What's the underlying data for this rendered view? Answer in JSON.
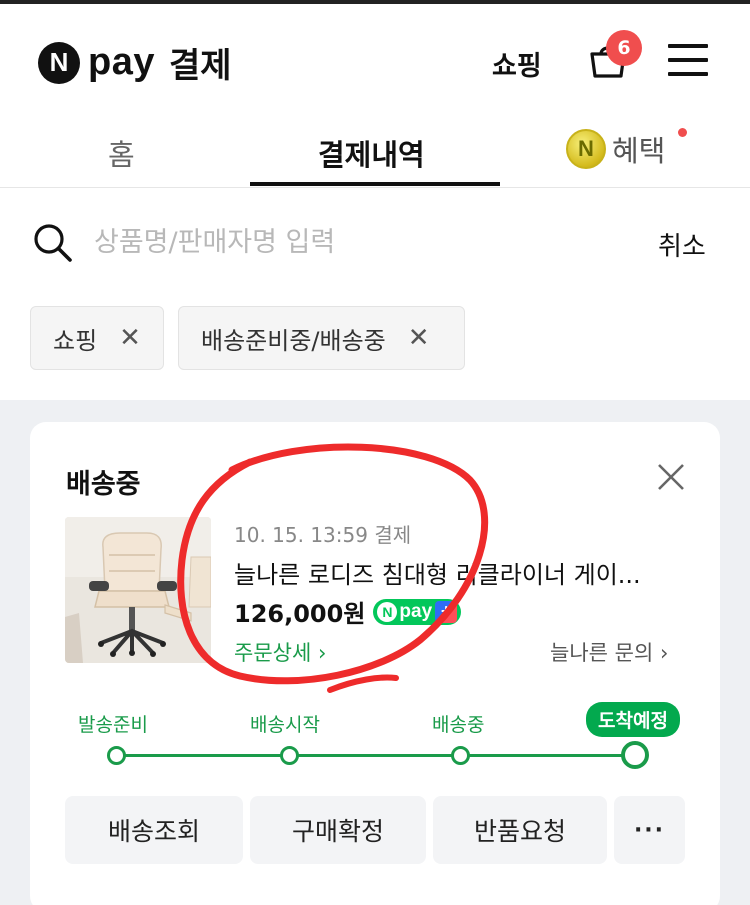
{
  "header": {
    "logo_n": "N",
    "logo_pay": "pay",
    "logo_title": "결제",
    "shop_link": "쇼핑",
    "cart_badge": "6"
  },
  "tabs": [
    {
      "label": "홈"
    },
    {
      "label": "결제내역"
    },
    {
      "label": "혜택",
      "coin": "N"
    }
  ],
  "search": {
    "placeholder": "상품명/판매자명 입력",
    "value": "",
    "cancel_label": "취소"
  },
  "filters": [
    {
      "label": "쇼핑"
    },
    {
      "label": "배송준비중/배송중"
    }
  ],
  "order": {
    "status": "배송중",
    "date": "10. 15. 13:59 결제",
    "product_name": "늘나른 로디즈 침대형 리클라이너 게이...",
    "price": "126,000원",
    "npay_badge_n": "N",
    "npay_badge_text": "pay",
    "order_detail_link": "주문상세",
    "seller_inquiry_link": "늘나른 문의"
  },
  "progress": {
    "steps": [
      "발송준비",
      "배송시작",
      "배송중",
      "도착예정"
    ],
    "current_step": 4
  },
  "actions": {
    "track": "배송조회",
    "confirm": "구매확정",
    "return": "반품요청",
    "more": "···"
  },
  "colors": {
    "accent_green": "#03c75a",
    "badge_red": "#f04e4e",
    "annotation_red": "#ee2b2b"
  }
}
